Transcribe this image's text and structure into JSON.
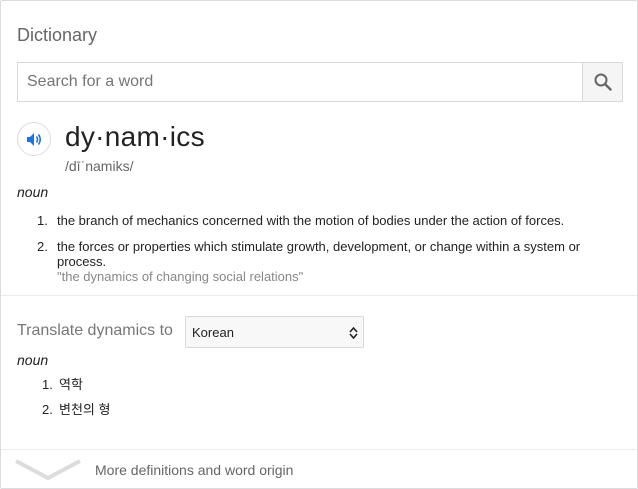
{
  "dictionary": {
    "title": "Dictionary",
    "search": {
      "placeholder": "Search for a word",
      "value": ""
    },
    "entry": {
      "word": "dy·nam·ics",
      "phonetic": "/dīˈnamiks/",
      "part_of_speech": "noun",
      "definitions": [
        {
          "number": "1.",
          "text": "the branch of mechanics concerned with the motion of bodies under the action of forces.",
          "example": ""
        },
        {
          "number": "2.",
          "text": "the forces or properties which stimulate growth, development, or change within a system or process.",
          "example": "\"the dynamics of changing social relations\""
        }
      ]
    },
    "translate": {
      "label": "Translate dynamics to",
      "selected_language": "Korean",
      "part_of_speech": "noun",
      "translations": [
        {
          "number": "1.",
          "text": "역학"
        },
        {
          "number": "2.",
          "text": "변천의 형"
        }
      ]
    },
    "more_link": "More definitions and word origin",
    "colors": {
      "accent_blue": "#1a73e8",
      "text": "#222222",
      "muted": "#878787"
    },
    "icons": [
      "search-icon",
      "speaker-icon",
      "select-arrows-icon",
      "chevron-down-icon"
    ]
  }
}
